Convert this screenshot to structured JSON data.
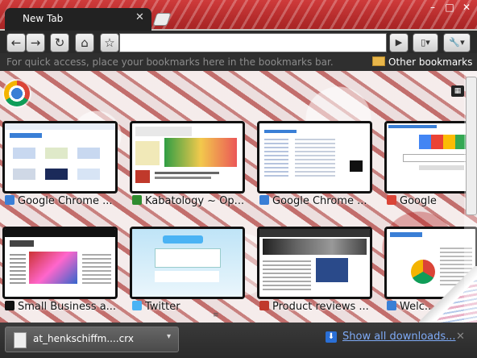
{
  "window": {
    "minimize": "–",
    "maximize": "□",
    "close": "✕"
  },
  "tab": {
    "title": "New Tab",
    "close": "✕"
  },
  "toolbar": {
    "back": "←",
    "forward": "→",
    "reload": "↻",
    "home": "⌂",
    "star": "☆",
    "go": "▶",
    "page_menu": "▯▾",
    "wrench_menu": "🔧▾",
    "omnibox_value": ""
  },
  "bookmarks_bar": {
    "hint": "For quick access, place your bookmarks here in the bookmarks bar.",
    "other": "Other bookmarks"
  },
  "thumbnails": [
    {
      "label": "Google Chrome ...",
      "fav_color": "#3a7fd6"
    },
    {
      "label": "Kabatology ~ Op...",
      "fav_color": "#2e8b2e"
    },
    {
      "label": "Google Chrome ...",
      "fav_color": "#3a7fd6"
    },
    {
      "label": "Google",
      "fav_color": "#db4437"
    },
    {
      "label": "Small Business a...",
      "fav_color": "#111111"
    },
    {
      "label": "Twitter",
      "fav_color": "#4ab3f4"
    },
    {
      "label": "Product reviews ...",
      "fav_color": "#c0392b"
    },
    {
      "label": "Welc...",
      "fav_color": "#3a7fd6"
    }
  ],
  "downloads": {
    "file": "at_henkschiffm....crx",
    "menu": "▾",
    "show_all": "Show all downloads...",
    "close": "✕"
  },
  "colors": {
    "titlebar": "#b62c2c",
    "toolbar": "#2a2a2a",
    "link": "#7eaaf5"
  }
}
